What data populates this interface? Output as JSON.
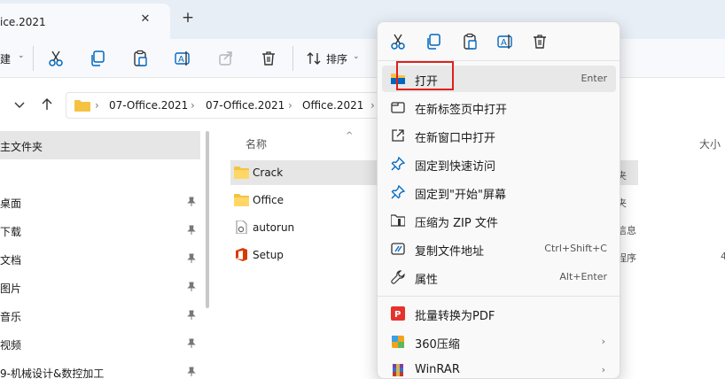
{
  "tab": {
    "title": "ice.2021",
    "close": "✕",
    "new_tab": "+"
  },
  "toolbar": {
    "new_label": "建",
    "sort_label": "排序",
    "icons": [
      "cut-icon",
      "copy-icon",
      "paste-icon",
      "rename-icon",
      "share-icon",
      "delete-icon",
      "sort-icon"
    ]
  },
  "address": {
    "crumbs": [
      "07-Office.2021",
      "07-Office.2021",
      "Office.2021"
    ],
    "separator": "›"
  },
  "sidebar": {
    "header": "主文件夹",
    "items": [
      "桌面",
      "下载",
      "文档",
      "图片",
      "音乐",
      "视频",
      "9-机械设计&数控加工"
    ]
  },
  "filelist": {
    "columns": {
      "name": "名称",
      "size": "大小"
    },
    "files": [
      {
        "name": "Crack",
        "icon": "folder-icon",
        "selected": true
      },
      {
        "name": "Office",
        "icon": "folder-icon",
        "selected": false
      },
      {
        "name": "autorun",
        "icon": "settings-file-icon",
        "selected": false
      },
      {
        "name": "Setup",
        "icon": "office-logo-icon",
        "selected": false
      }
    ],
    "type_peek": [
      "夹",
      "夹",
      "信息",
      "程序"
    ],
    "size_peek": "4"
  },
  "context_menu": {
    "top_icons": [
      "cut-icon",
      "copy-icon",
      "paste-icon",
      "rename-icon",
      "delete-icon"
    ],
    "items": [
      {
        "label": "打开",
        "shortcut": "Enter",
        "icon": "open-folder-icon"
      },
      {
        "label": "在新标签页中打开",
        "shortcut": "",
        "icon": "new-tab-icon"
      },
      {
        "label": "在新窗口中打开",
        "shortcut": "",
        "icon": "new-window-icon"
      },
      {
        "label": "固定到快速访问",
        "shortcut": "",
        "icon": "pin-icon"
      },
      {
        "label": "固定到\"开始\"屏幕",
        "shortcut": "",
        "icon": "pin-icon"
      },
      {
        "label": "压缩为 ZIP 文件",
        "shortcut": "",
        "icon": "zip-icon"
      },
      {
        "label": "复制文件地址",
        "shortcut": "Ctrl+Shift+C",
        "icon": "copy-path-icon"
      },
      {
        "label": "属性",
        "shortcut": "Alt+Enter",
        "icon": "wrench-icon"
      },
      {
        "label": "批量转换为PDF",
        "shortcut": "",
        "icon": "pdf-icon"
      },
      {
        "label": "360压缩",
        "shortcut": "",
        "icon": "360-zip-icon",
        "submenu": "›"
      },
      {
        "label": "WinRAR",
        "shortcut": "",
        "icon": "winrar-icon",
        "submenu": "›"
      }
    ]
  },
  "colors": {
    "accent": "#0067c0",
    "highlight": "#e0201b",
    "folder": "#f5c342"
  }
}
